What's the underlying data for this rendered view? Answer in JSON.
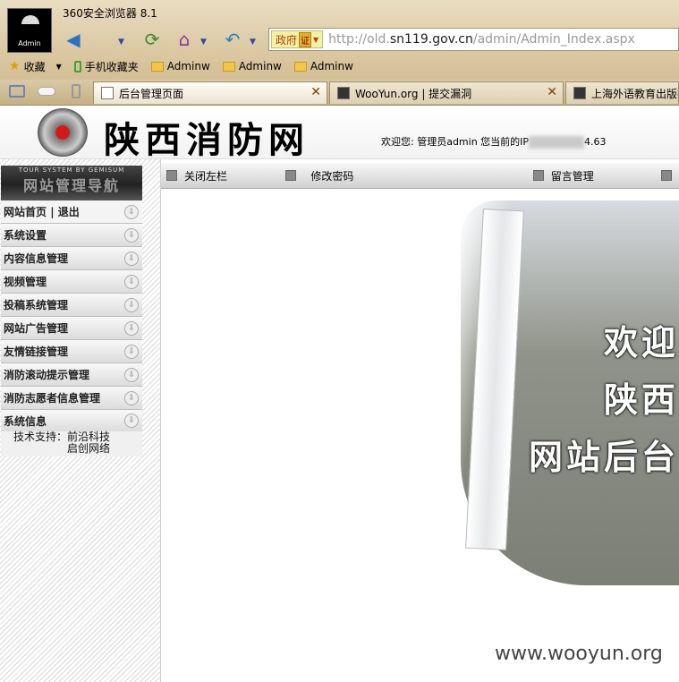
{
  "browser": {
    "title": "360安全浏览器 8.1",
    "avatar_text": "Admin",
    "address": {
      "badge": "政府",
      "badge_cert": "证",
      "url_prefix": "http://old.",
      "url_domain": "sn119.gov.cn",
      "url_path": "/admin/Admin_Index.aspx"
    },
    "favorites": [
      {
        "label": "收藏",
        "icon": "star-icon"
      },
      {
        "label": "手机收藏夹",
        "icon": "phone-icon"
      },
      {
        "label": "Adminw",
        "icon": "folder-icon"
      },
      {
        "label": "Adminw",
        "icon": "folder-icon"
      },
      {
        "label": "Adminw",
        "icon": "folder-icon"
      }
    ],
    "tabs": [
      {
        "label": "后台管理页面",
        "active": true
      },
      {
        "label": "WooYun.org | 提交漏洞",
        "active": false
      },
      {
        "label": "上海外语教育出版社",
        "active": false
      }
    ]
  },
  "site": {
    "title": "陕西消防网",
    "welcome_prefix": "欢迎您: 管理员admin 您当前的IP",
    "welcome_ip_tail": "4.63"
  },
  "sidebar": {
    "header_small": "TOUR SYSTEM BY GEMISUM",
    "header_big": "网站管理导航",
    "home": "网站首页",
    "logout": "退出",
    "items": [
      "系统设置",
      "内容信息管理",
      "视频管理",
      "投稿系统管理",
      "网站广告管理",
      "友情链接管理",
      "消防滚动提示管理",
      "消防志愿者信息管理",
      "系统信息"
    ],
    "support_label": "技术支持：",
    "support_lines": [
      "前沿科技",
      "启创网络"
    ]
  },
  "topnav": {
    "close_left": "关闭左栏",
    "change_password": "修改密码",
    "guestbook": "留言管理"
  },
  "main": {
    "welcome_lines": [
      "欢迎",
      "陕西",
      "网站后台"
    ]
  },
  "watermark": "www.wooyun.org"
}
